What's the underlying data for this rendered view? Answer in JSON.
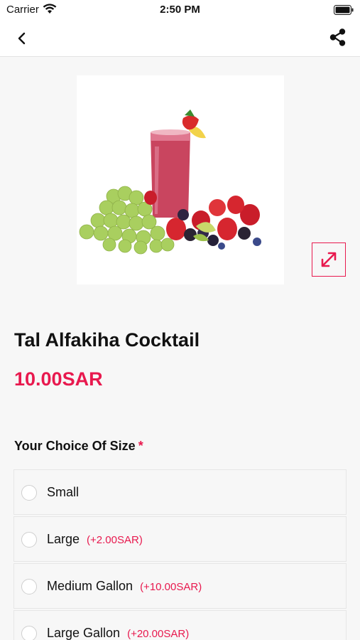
{
  "status_bar": {
    "carrier": "Carrier",
    "time": "2:50 PM"
  },
  "nav": {
    "back_icon": "chevron-left-icon",
    "share_icon": "share-icon"
  },
  "product": {
    "title": "Tal Alfakiha Cocktail",
    "price": "10.00SAR",
    "expand_icon": "expand-icon"
  },
  "size_section": {
    "heading": "Your Choice Of Size",
    "required_mark": "*",
    "options": [
      {
        "label": "Small",
        "extra": ""
      },
      {
        "label": "Large",
        "extra": "(+2.00SAR)"
      },
      {
        "label": "Medium Gallon",
        "extra": "(+10.00SAR)"
      },
      {
        "label": "Large Gallon",
        "extra": "(+20.00SAR)"
      }
    ]
  },
  "colors": {
    "accent": "#e8194e",
    "background": "#f7f7f7"
  }
}
